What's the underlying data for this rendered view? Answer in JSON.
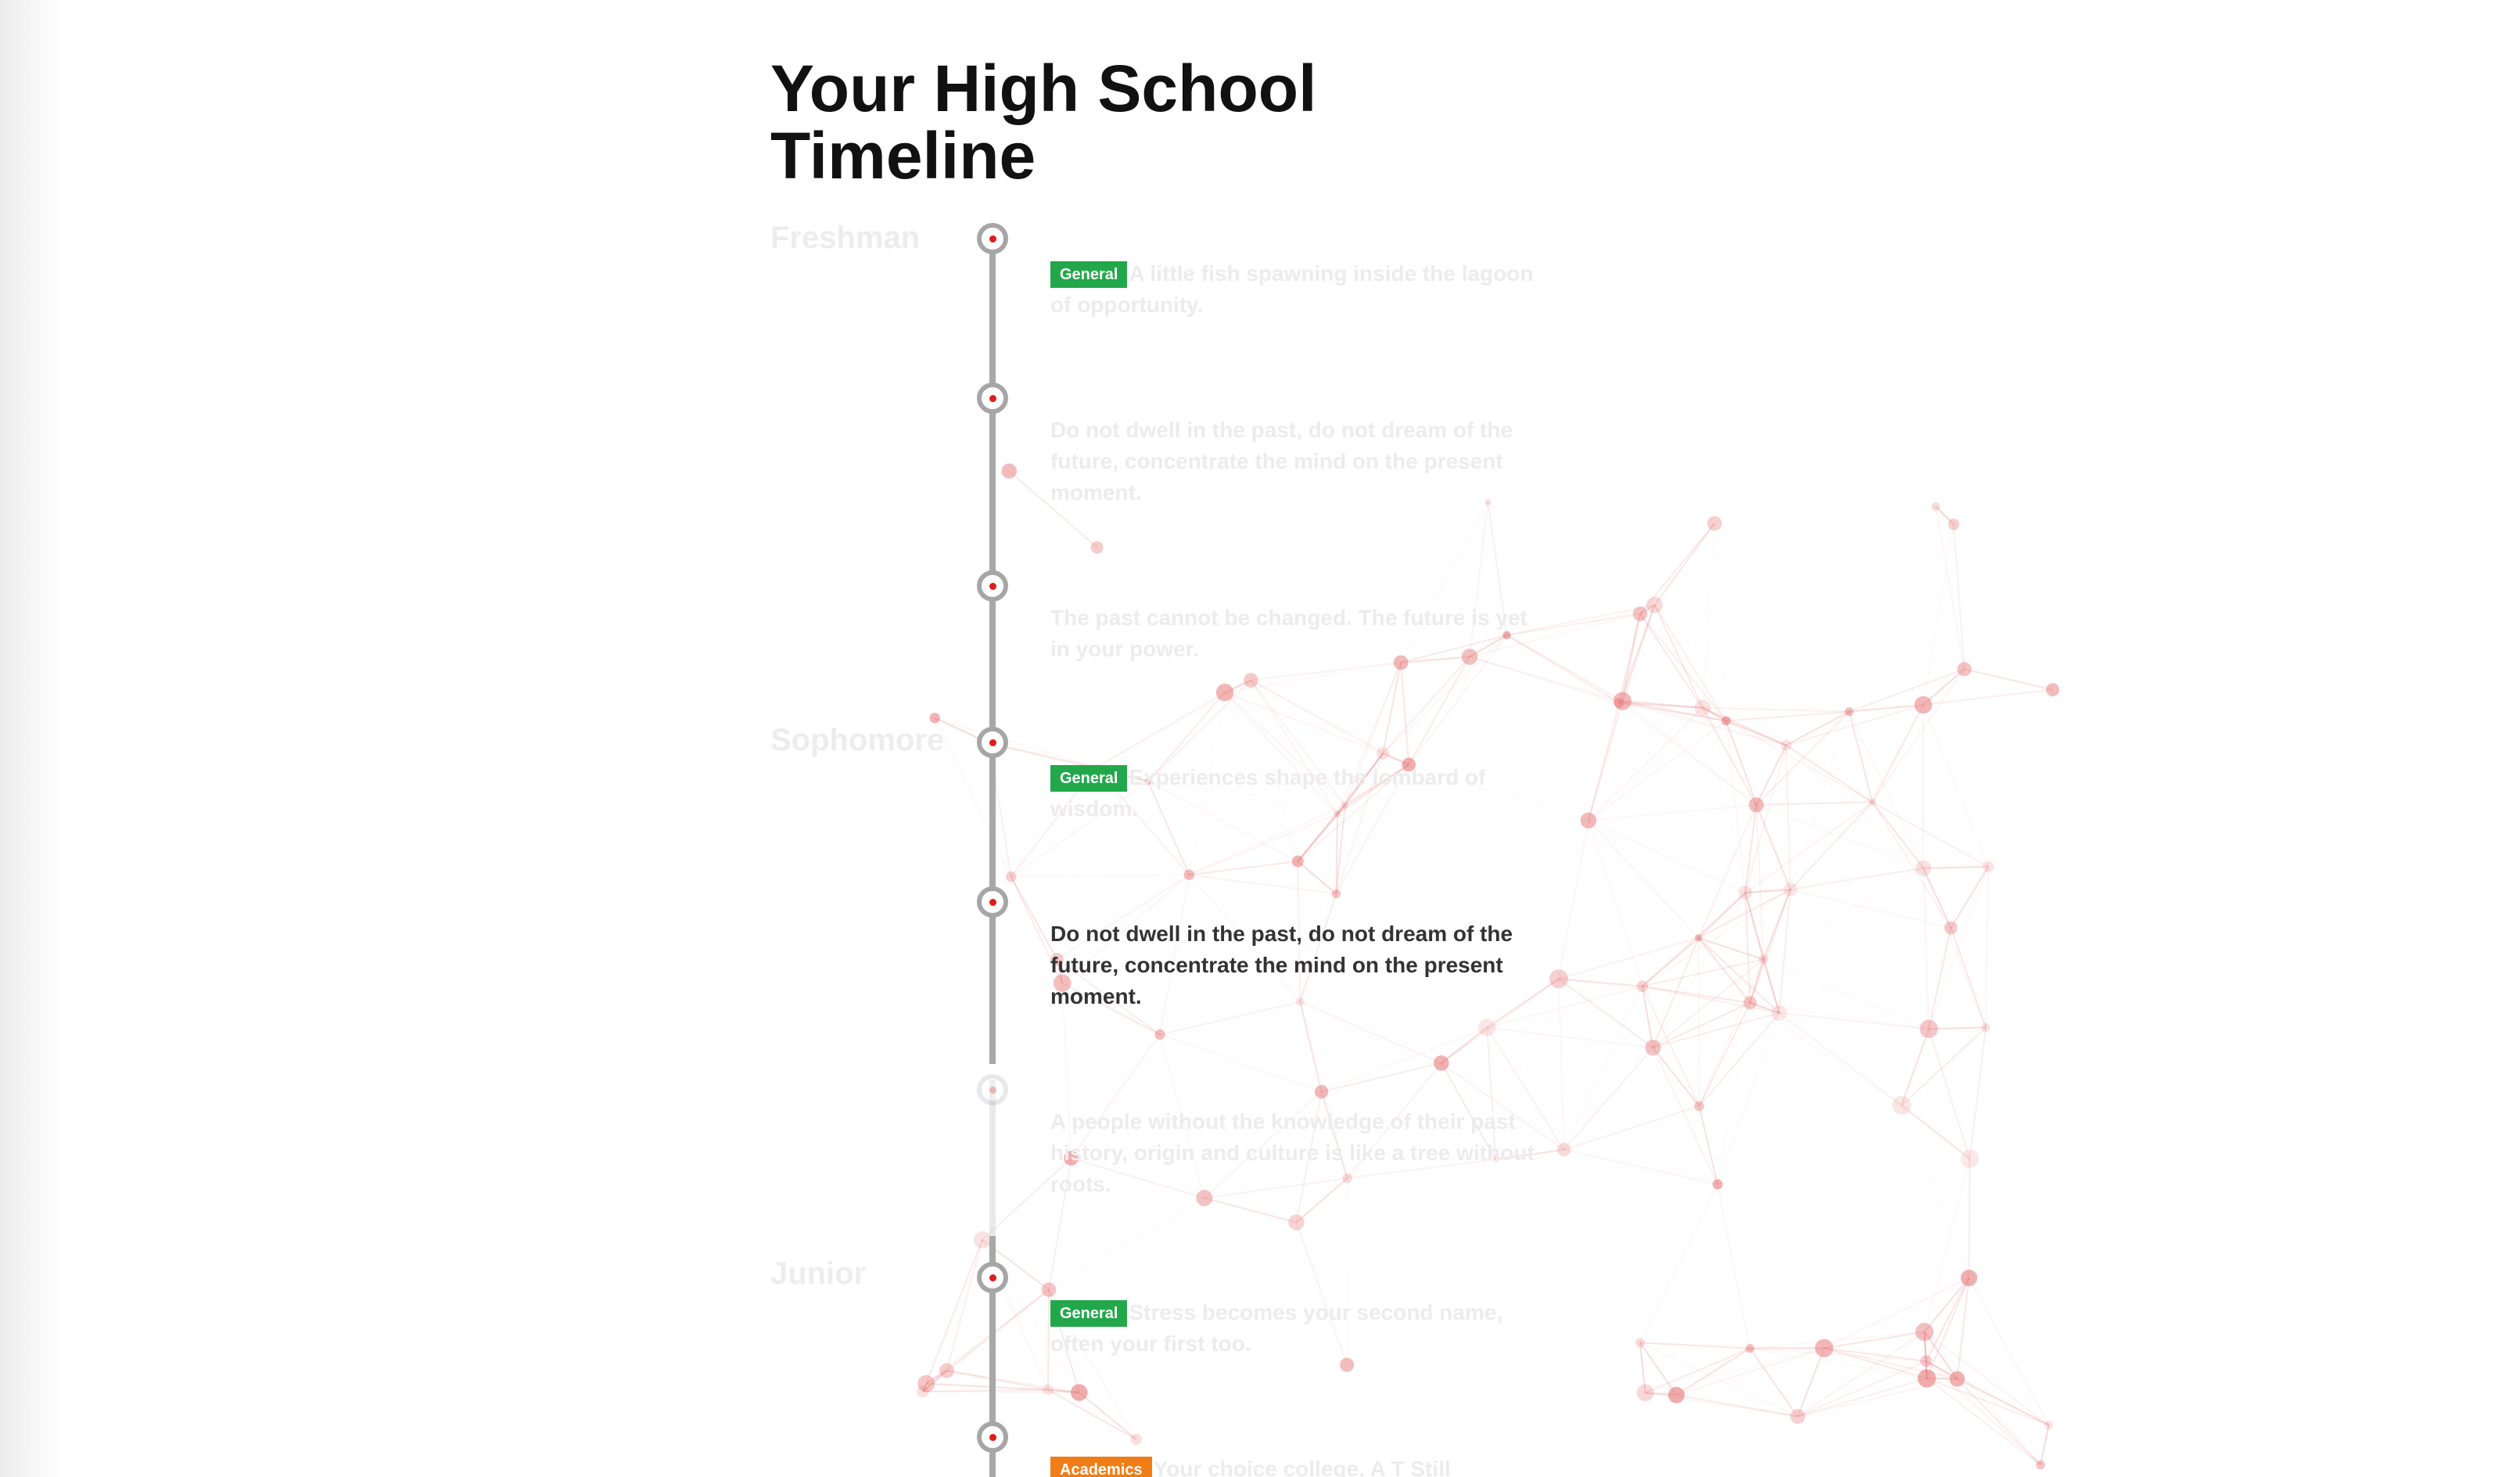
{
  "title": "Your High School\nTimeline",
  "colors": {
    "general": "#22a84a",
    "academics": "#f07d16",
    "node_dot": "#e01c1c",
    "line": "#a8a8a8",
    "network": "#e57373"
  },
  "years": [
    {
      "label": "Freshman"
    },
    {
      "label": "Sophomore"
    },
    {
      "label": "Junior"
    }
  ],
  "events": [
    {
      "category": "General",
      "text": "A little fish spawning inside the lagoon of opportunity."
    },
    {
      "category": "",
      "text": "Do not dwell in the past, do not dream of the future, concentrate the mind on the present moment."
    },
    {
      "category": "",
      "text": "The past cannot be changed. The future is yet in your power."
    },
    {
      "category": "General",
      "text": "Experiences shape the lombard of wisdom."
    },
    {
      "category": "",
      "text": "Do not dwell in the past, do not dream of the future, concentrate the mind on the present moment."
    },
    {
      "category": "",
      "text": "A people without the knowledge of their past history, origin and culture is like a tree without roots."
    },
    {
      "category": "General",
      "text": "Stress becomes your second name, often your first too."
    },
    {
      "category": "Academics",
      "text": "Your choice college, A T Still"
    }
  ]
}
